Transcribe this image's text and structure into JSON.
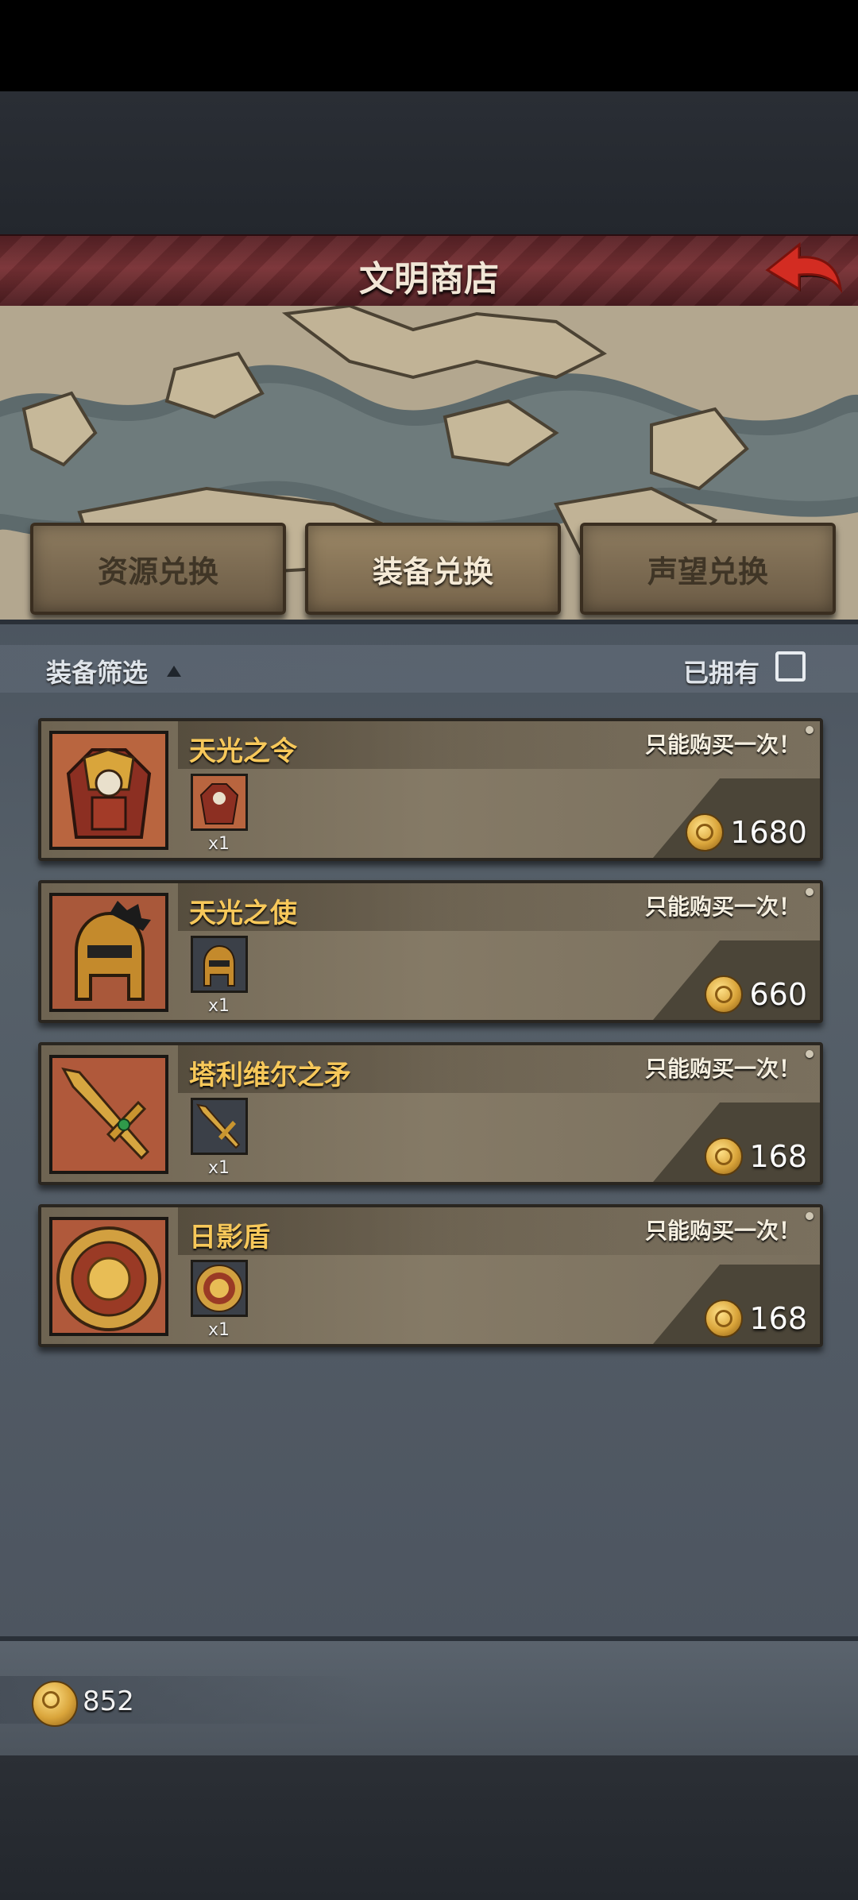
{
  "header": {
    "title": "文明商店",
    "back_icon": "back-arrow-icon",
    "back_color": "#c8291f"
  },
  "tabs": [
    {
      "label": "资源兑换",
      "active": false
    },
    {
      "label": "装备兑换",
      "active": true
    },
    {
      "label": "声望兑换",
      "active": false
    }
  ],
  "filter": {
    "label": "装备筛选",
    "owned_label": "已拥有",
    "owned_checked": false
  },
  "items": [
    {
      "name": "天光之令",
      "limit": "只能购买一次！",
      "qty": "x1",
      "price": "1680",
      "icon": "golden-armor-icon"
    },
    {
      "name": "天光之使",
      "limit": "只能购买一次！",
      "qty": "x1",
      "price": "660",
      "icon": "golden-helmet-icon"
    },
    {
      "name": "塔利维尔之矛",
      "limit": "只能购买一次！",
      "qty": "x1",
      "price": "168",
      "icon": "spear-icon"
    },
    {
      "name": "日影盾",
      "limit": "只能购买一次！",
      "qty": "x1",
      "price": "168",
      "icon": "sun-shield-icon"
    }
  ],
  "currency": {
    "amount": "852",
    "icon": "gold-coin-icon"
  },
  "colors": {
    "name_gold": "#f7c85a",
    "title_bar": "#7a3236"
  }
}
